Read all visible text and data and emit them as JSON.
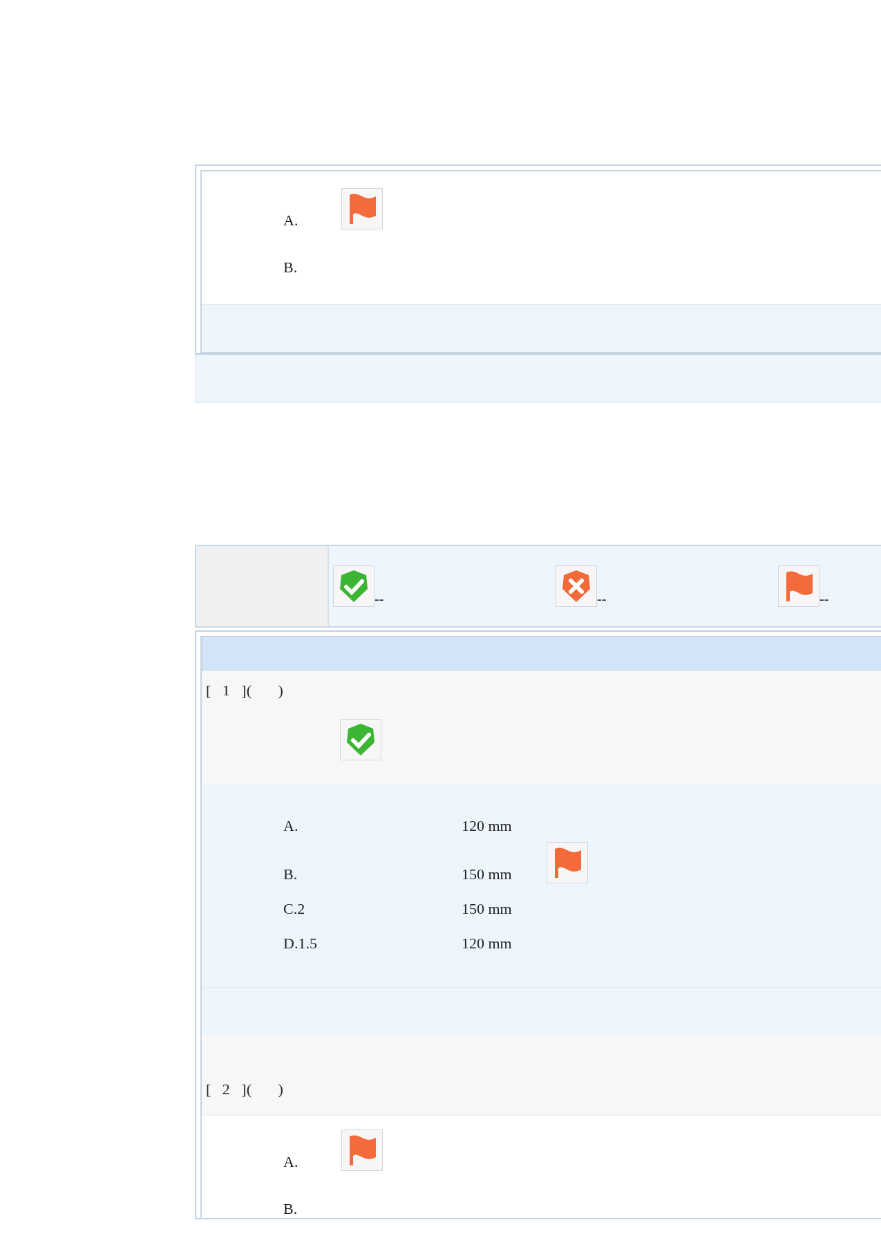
{
  "top_question": {
    "options": [
      {
        "label": "A.",
        "flagged": true
      },
      {
        "label": "B.",
        "flagged": false
      }
    ]
  },
  "legend": [
    {
      "kind": "correct",
      "text": "--"
    },
    {
      "kind": "wrong",
      "text": "--"
    },
    {
      "kind": "flag",
      "text": "--"
    }
  ],
  "questions": [
    {
      "stem": "[   1   ](       )",
      "correct_mark": true,
      "options": [
        {
          "label": "A.",
          "value": "120 mm",
          "flagged": false
        },
        {
          "label": "B.",
          "value": "150 mm",
          "flagged": true
        },
        {
          "label": "C.2",
          "value": "150 mm",
          "flagged": false
        },
        {
          "label": "D.1.5",
          "value": "120 mm",
          "flagged": false
        }
      ]
    },
    {
      "stem": "[   2   ](       )",
      "correct_mark": false,
      "options": [
        {
          "label": "A.",
          "flagged": true
        },
        {
          "label": "B.",
          "flagged": false
        }
      ]
    }
  ]
}
